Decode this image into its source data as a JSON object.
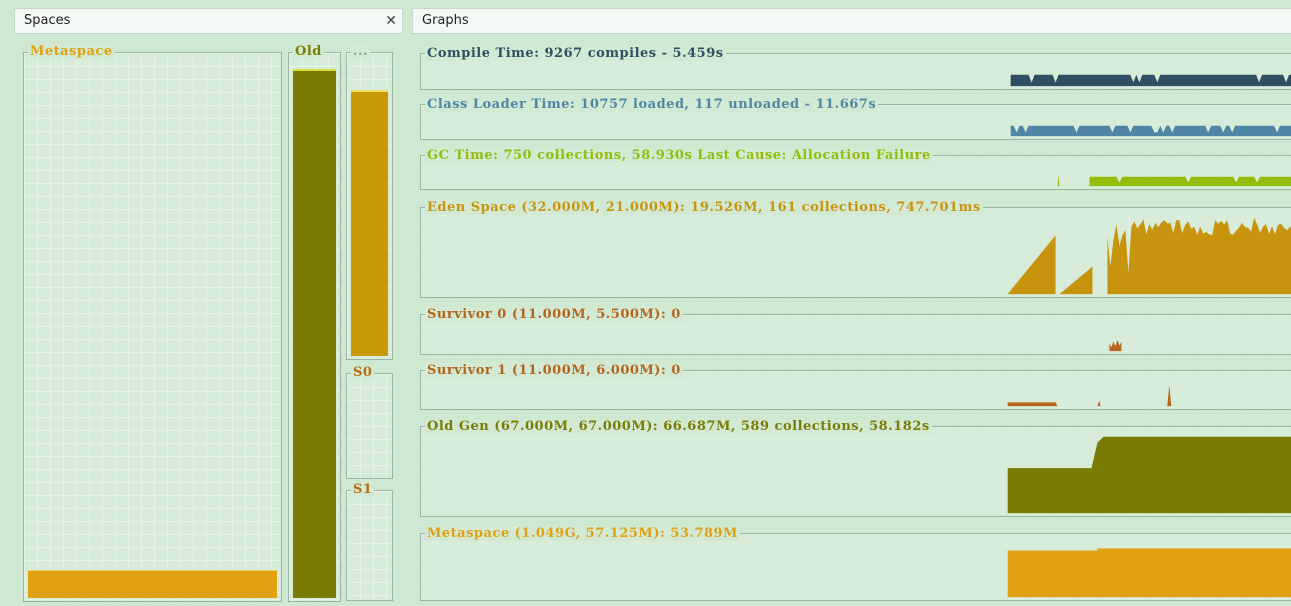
{
  "tabs": {
    "spaces": "Spaces",
    "graphs": "Graphs",
    "close_icon": "close-icon"
  },
  "spaces": {
    "metaspace": {
      "label": "Metaspace",
      "color": "#e0a010",
      "fill_fraction": 0.05
    },
    "old": {
      "label": "Old",
      "color": "#7a7d05",
      "fill_fraction": 0.99
    },
    "eden": {
      "label": "...",
      "color": "#c8980a",
      "fill_fraction": 0.88
    },
    "s0": {
      "label": "S0",
      "color": "#b86a10",
      "fill_fraction": 0
    },
    "s1": {
      "label": "S1",
      "color": "#b86a10",
      "fill_fraction": 0
    }
  },
  "graphs": [
    {
      "title": "Compile Time: 9267 compiles - 5.459s",
      "color": "#2f5063"
    },
    {
      "title": "Class Loader Time: 10757 loaded, 117 unloaded - 11.667s",
      "color": "#4f86a6"
    },
    {
      "title": "GC Time: 750 collections, 58.930s  Last Cause: Allocation Failure",
      "color": "#92bd0a"
    },
    {
      "title": "Eden Space (32.000M, 21.000M): 19.526M, 161 collections, 747.701ms",
      "color": "#c8940e"
    },
    {
      "title": "Survivor 0 (11.000M, 5.500M): 0",
      "color": "#b5651d"
    },
    {
      "title": "Survivor 1 (11.000M, 6.000M): 0",
      "color": "#b5651d"
    },
    {
      "title": "Old Gen (67.000M, 67.000M): 66.687M, 589 collections, 58.182s",
      "color": "#7a7d05"
    },
    {
      "title": "Metaspace (1.049G, 57.125M): 53.789M",
      "color": "#e0a010"
    }
  ]
}
